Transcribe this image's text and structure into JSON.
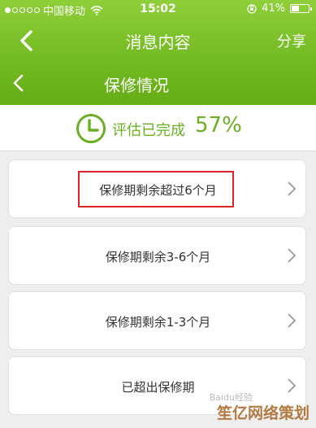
{
  "status_bar": {
    "carrier": "中国移动",
    "time": "15:02",
    "battery": "41%"
  },
  "nav": {
    "title": "消息内容",
    "share_label": "分享"
  },
  "subheader": {
    "title": "保修情况"
  },
  "progress": {
    "label": "评估已完成",
    "value": "57%"
  },
  "options": [
    {
      "label": "保修期剩余超过6个月"
    },
    {
      "label": "保修期剩余3-6个月"
    },
    {
      "label": "保修期剩余1-3个月"
    },
    {
      "label": "已超出保修期"
    }
  ],
  "watermark": {
    "text": "笙亿网络策划",
    "sub": "Baidu经验"
  },
  "colors": {
    "brand_green": "#74bb23",
    "accent_text": "#6ab022",
    "highlight": "#e0242a"
  }
}
